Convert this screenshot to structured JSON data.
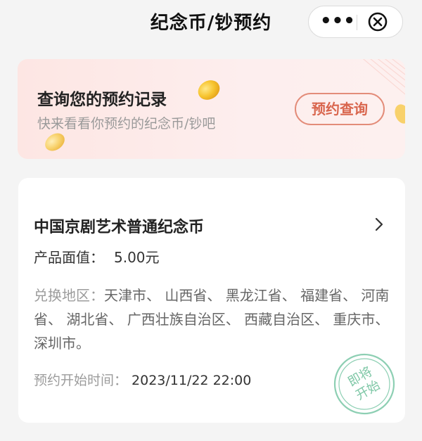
{
  "header": {
    "title": "纪念币/钞预约",
    "more_label": "•••",
    "close_icon": "close-circle-icon"
  },
  "banner": {
    "title": "查询您的预约记录",
    "subtitle": "快来看看你预约的纪念币/钞吧",
    "button_label": "预约查询",
    "coin_icon": "gold-coin-icon",
    "accent_color": "#d9664e"
  },
  "card": {
    "title": "中国京剧艺术普通纪念币",
    "face_value_label": "产品面值：",
    "face_value": "5.00元",
    "region_label": "兑换地区：",
    "regions": "天津市、 山西省、 黑龙江省、 福建省、 河南省、 湖北省、 广西壮族自治区、 西藏自治区、 重庆市、 深圳市。",
    "start_time_label": "预约开始时间：",
    "start_time": "2023/11/22 22:00",
    "stamp_line1": "即将",
    "stamp_line2": "开始",
    "stamp_color": "#7ec7a6"
  }
}
